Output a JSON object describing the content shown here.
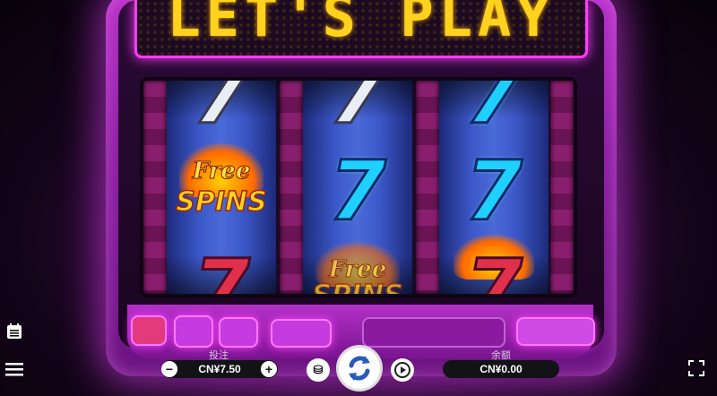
{
  "marquee": {
    "text": "LET'S PLAY"
  },
  "reels": [
    {
      "top": "7",
      "mid_free": "Free",
      "mid_spins": "SPINS",
      "bottom": "7"
    },
    {
      "top": "7",
      "mid": "7",
      "bottom_free": "Free",
      "bottom_spins": "SPINS"
    },
    {
      "top": "7",
      "mid": "7",
      "bottom": "7"
    }
  ],
  "bet": {
    "label": "投注",
    "value": "CN¥7.50",
    "minus": "−",
    "plus": "+"
  },
  "balance": {
    "label": "余额",
    "value": "CN¥0.00"
  },
  "icons": {
    "menu": "menu-icon",
    "history": "history-icon",
    "fullscreen": "fullscreen-icon",
    "spin": "spin-icon",
    "autoplay": "autoplay-icon",
    "bet_settings": "bet-settings-icon"
  },
  "colors": {
    "accent": "#ff3cff",
    "marquee_text": "#ffd21e",
    "seven_cyan": "#1fd0ff"
  }
}
